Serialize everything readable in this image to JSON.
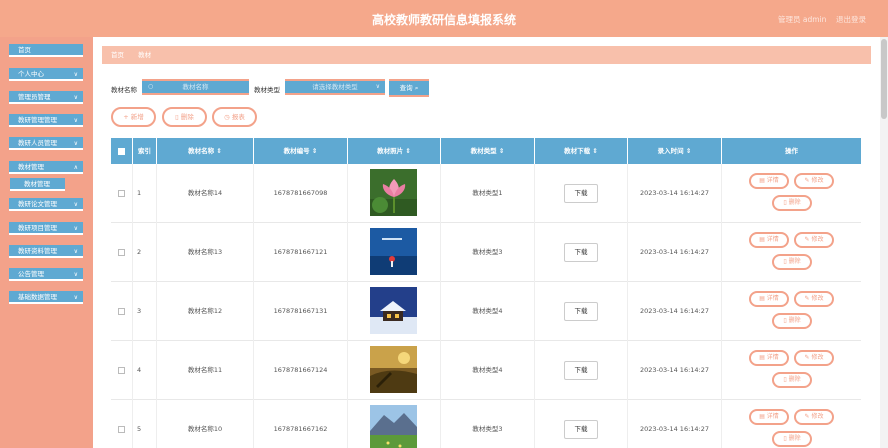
{
  "header": {
    "title": "高校教师教研信息填报系统",
    "user": "管理员 admin",
    "logout": "退出登录"
  },
  "sidebar": {
    "items": [
      {
        "label": "首页",
        "has_chevron": false
      },
      {
        "label": "个人中心",
        "has_chevron": true
      },
      {
        "label": "管理员管理",
        "has_chevron": true
      },
      {
        "label": "教研管理管理",
        "has_chevron": true
      },
      {
        "label": "教研人员管理",
        "has_chevron": true
      },
      {
        "label": "教材管理",
        "has_chevron": true
      },
      {
        "label": "教研论文管理",
        "has_chevron": true
      },
      {
        "label": "教研项目管理",
        "has_chevron": true
      },
      {
        "label": "教研资料管理",
        "has_chevron": true
      },
      {
        "label": "公告管理",
        "has_chevron": true
      },
      {
        "label": "基础数据管理",
        "has_chevron": true
      }
    ],
    "submenu": {
      "label": "教材管理"
    }
  },
  "breadcrumb": {
    "home": "首页",
    "current": "教材"
  },
  "search": {
    "name_label": "教材名称",
    "name_placeholder": "教材名称",
    "type_label": "教材类型",
    "type_placeholder": "请选择教材类型",
    "query_label": "查询"
  },
  "actions": {
    "add": "新增",
    "delete": "删除",
    "report": "报表"
  },
  "table": {
    "headers": [
      "",
      "索引",
      "教材名称",
      "教材编号",
      "教材照片",
      "教材类型",
      "教材下载",
      "录入时间",
      "操作"
    ],
    "download_label": "下载",
    "detail_label": "详情",
    "edit_label": "修改",
    "delete_label": "删除",
    "rows": [
      {
        "index": "1",
        "name": "教材名称14",
        "code": "1678781667098",
        "type": "教材类型1",
        "time": "2023-03-14 16:14:27",
        "photo": "lotus"
      },
      {
        "index": "2",
        "name": "教材名称13",
        "code": "1678781667121",
        "type": "教材类型3",
        "time": "2023-03-14 16:14:27",
        "photo": "blue-scene"
      },
      {
        "index": "3",
        "name": "教材名称12",
        "code": "1678781667131",
        "type": "教材类型4",
        "time": "2023-03-14 16:14:27",
        "photo": "snow-house"
      },
      {
        "index": "4",
        "name": "教材名称11",
        "code": "1678781667124",
        "type": "教材类型4",
        "time": "2023-03-14 16:14:27",
        "photo": "sunset-field"
      },
      {
        "index": "5",
        "name": "教材名称10",
        "code": "1678781667162",
        "type": "教材类型3",
        "time": "2023-03-14 16:14:27",
        "photo": "mountain"
      }
    ]
  },
  "colors": {
    "accent": "#f3a28a",
    "primary": "#5fa9d2"
  }
}
